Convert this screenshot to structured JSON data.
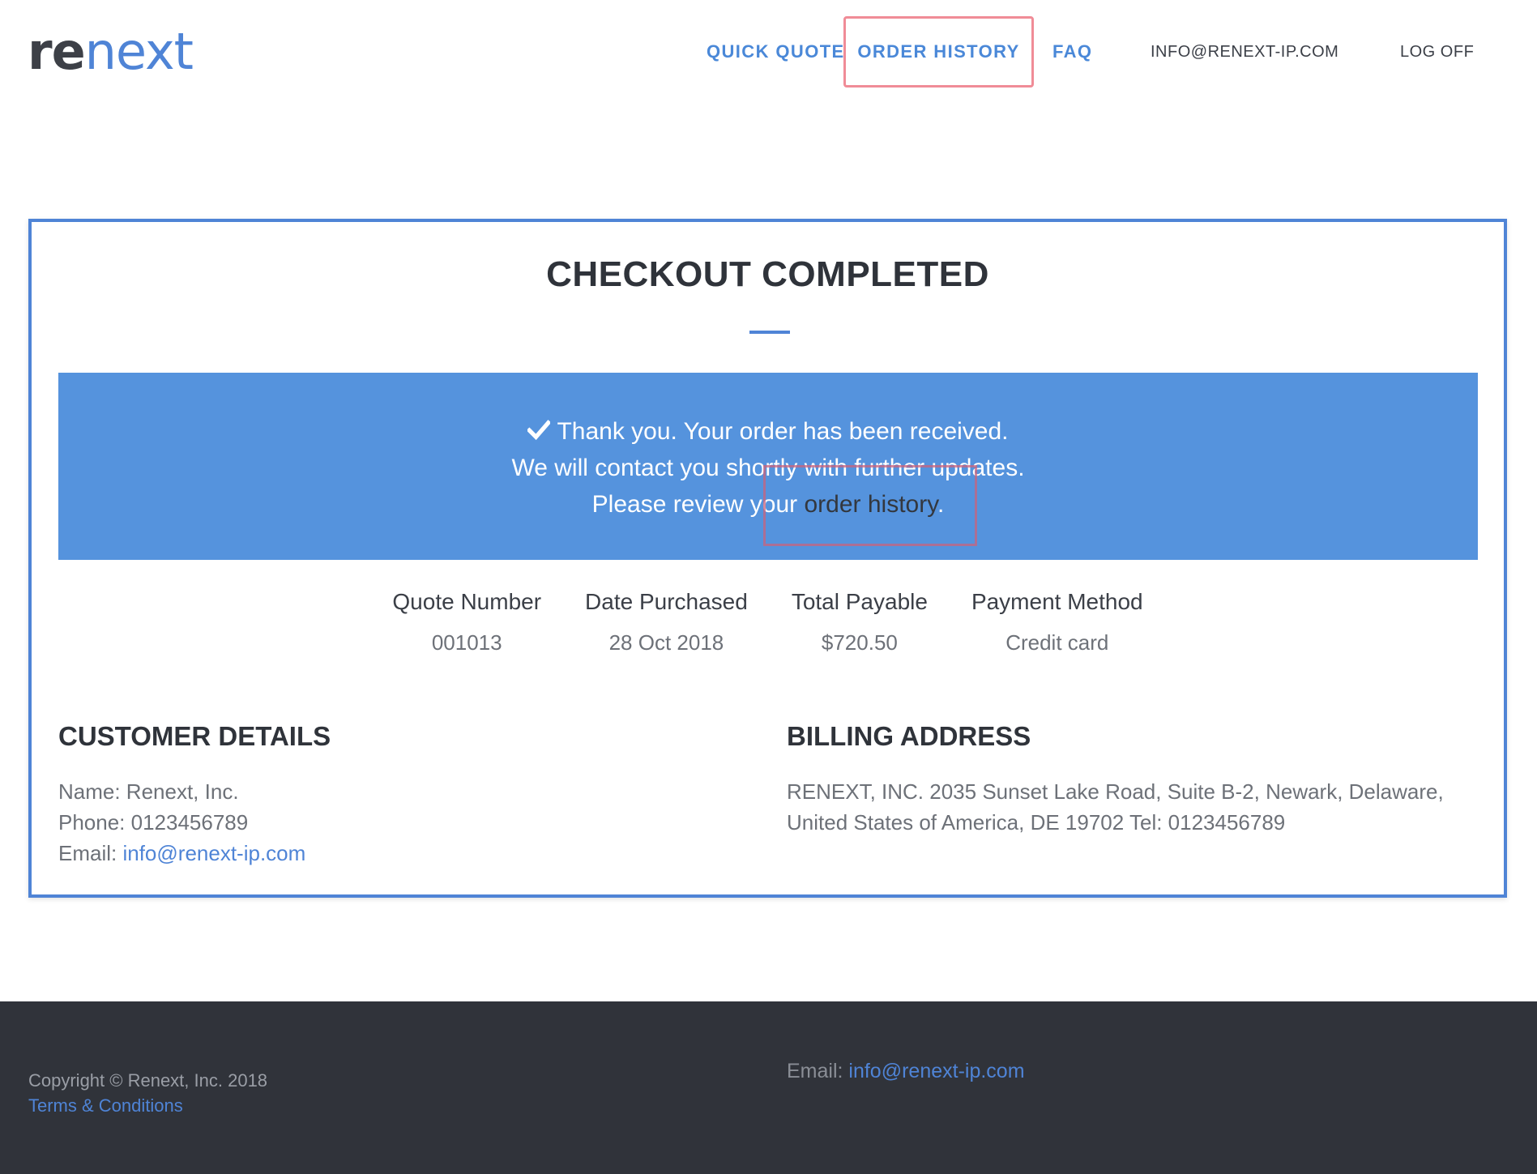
{
  "header": {
    "logo_re": "re",
    "logo_next": "next",
    "nav": {
      "quick_quote": "QUICK QUOTE",
      "order_history": "ORDER HISTORY",
      "faq": "FAQ",
      "email": "INFO@RENEXT-IP.COM",
      "log_off": "LOG OFF"
    }
  },
  "checkout": {
    "title": "CHECKOUT COMPLETED",
    "banner": {
      "line1": "Thank you. Your order has been received.",
      "line2": "We will contact you shortly with further updates.",
      "line3_prefix": "Please review your ",
      "line3_link": "order history",
      "line3_suffix": "."
    },
    "summary": [
      {
        "label": "Quote Number",
        "value": "001013"
      },
      {
        "label": "Date Purchased",
        "value": "28 Oct 2018"
      },
      {
        "label": "Total Payable",
        "value": "$720.50"
      },
      {
        "label": "Payment Method",
        "value": "Credit card"
      }
    ],
    "customer": {
      "heading": "CUSTOMER DETAILS",
      "name": "Name: Renext, Inc.",
      "phone": "Phone: 0123456789",
      "email_label": "Email: ",
      "email": "info@renext-ip.com"
    },
    "billing": {
      "heading": "BILLING ADDRESS",
      "address": "RENEXT, INC. 2035 Sunset Lake Road, Suite B-2, Newark, Delaware, United States of America, DE 19702 Tel: 0123456789"
    }
  },
  "footer": {
    "copyright": "Copyright © Renext, Inc. 2018",
    "terms": "Terms & Conditions",
    "email_label": "Email: ",
    "email": "info@renext-ip.com"
  },
  "colors": {
    "accent": "#4f84d6",
    "banner": "#5593dd",
    "footer_bg": "#30333a",
    "highlight": "#f08c97"
  }
}
